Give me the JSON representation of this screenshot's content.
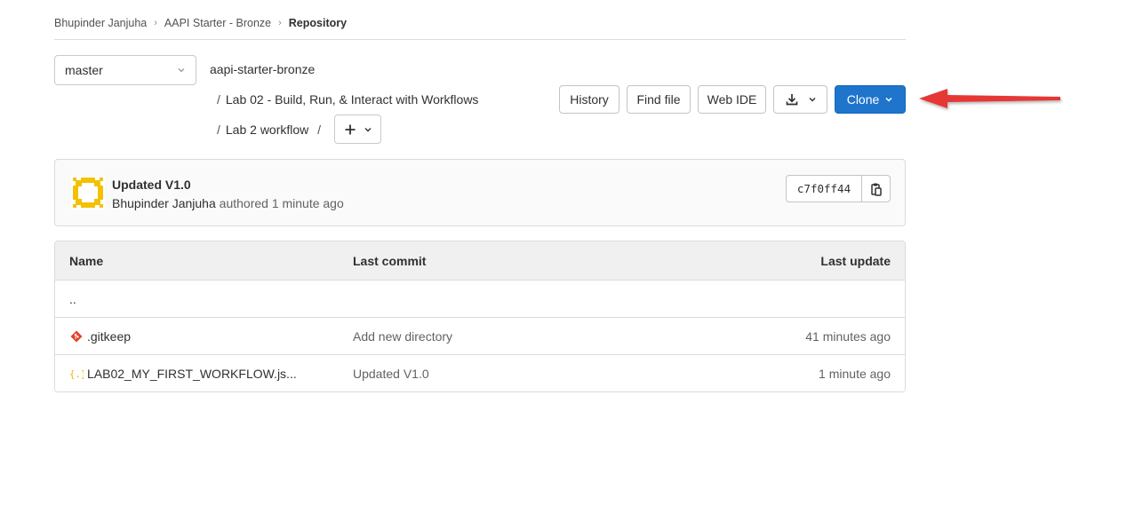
{
  "breadcrumbs": {
    "items": [
      "Bhupinder Janjuha",
      "AAPI Starter - Bronze"
    ],
    "current": "Repository"
  },
  "branch": {
    "selected": "master"
  },
  "path": {
    "project": "aapi-starter-bronze",
    "folder": "Lab 02 - Build, Run, & Interact with Workflows",
    "subfolder": "Lab 2 workflow",
    "trailing_slash": "/",
    "slash": "/"
  },
  "toolbar": {
    "history_label": "History",
    "find_file_label": "Find file",
    "web_ide_label": "Web IDE",
    "clone_label": "Clone"
  },
  "commit": {
    "title": "Updated V1.0",
    "author": "Bhupinder Janjuha",
    "meta": "authored 1 minute ago",
    "sha": "c7f0ff44"
  },
  "file_table": {
    "headers": {
      "name": "Name",
      "last_commit": "Last commit",
      "last_update": "Last update"
    },
    "parent_link": "..",
    "rows": [
      {
        "name": ".gitkeep",
        "icon": "git-icon",
        "last_commit": "Add new directory",
        "last_update": "41 minutes ago"
      },
      {
        "name": "LAB02_MY_FIRST_WORKFLOW.js...",
        "icon": "json-icon",
        "last_commit": "Updated V1.0",
        "last_update": "1 minute ago"
      }
    ]
  },
  "colors": {
    "primary": "#1f75cb",
    "annotation_arrow": "#e53935",
    "avatar": "#f2c200",
    "git_icon": "#e24329",
    "json_icon": "#f0b400"
  }
}
